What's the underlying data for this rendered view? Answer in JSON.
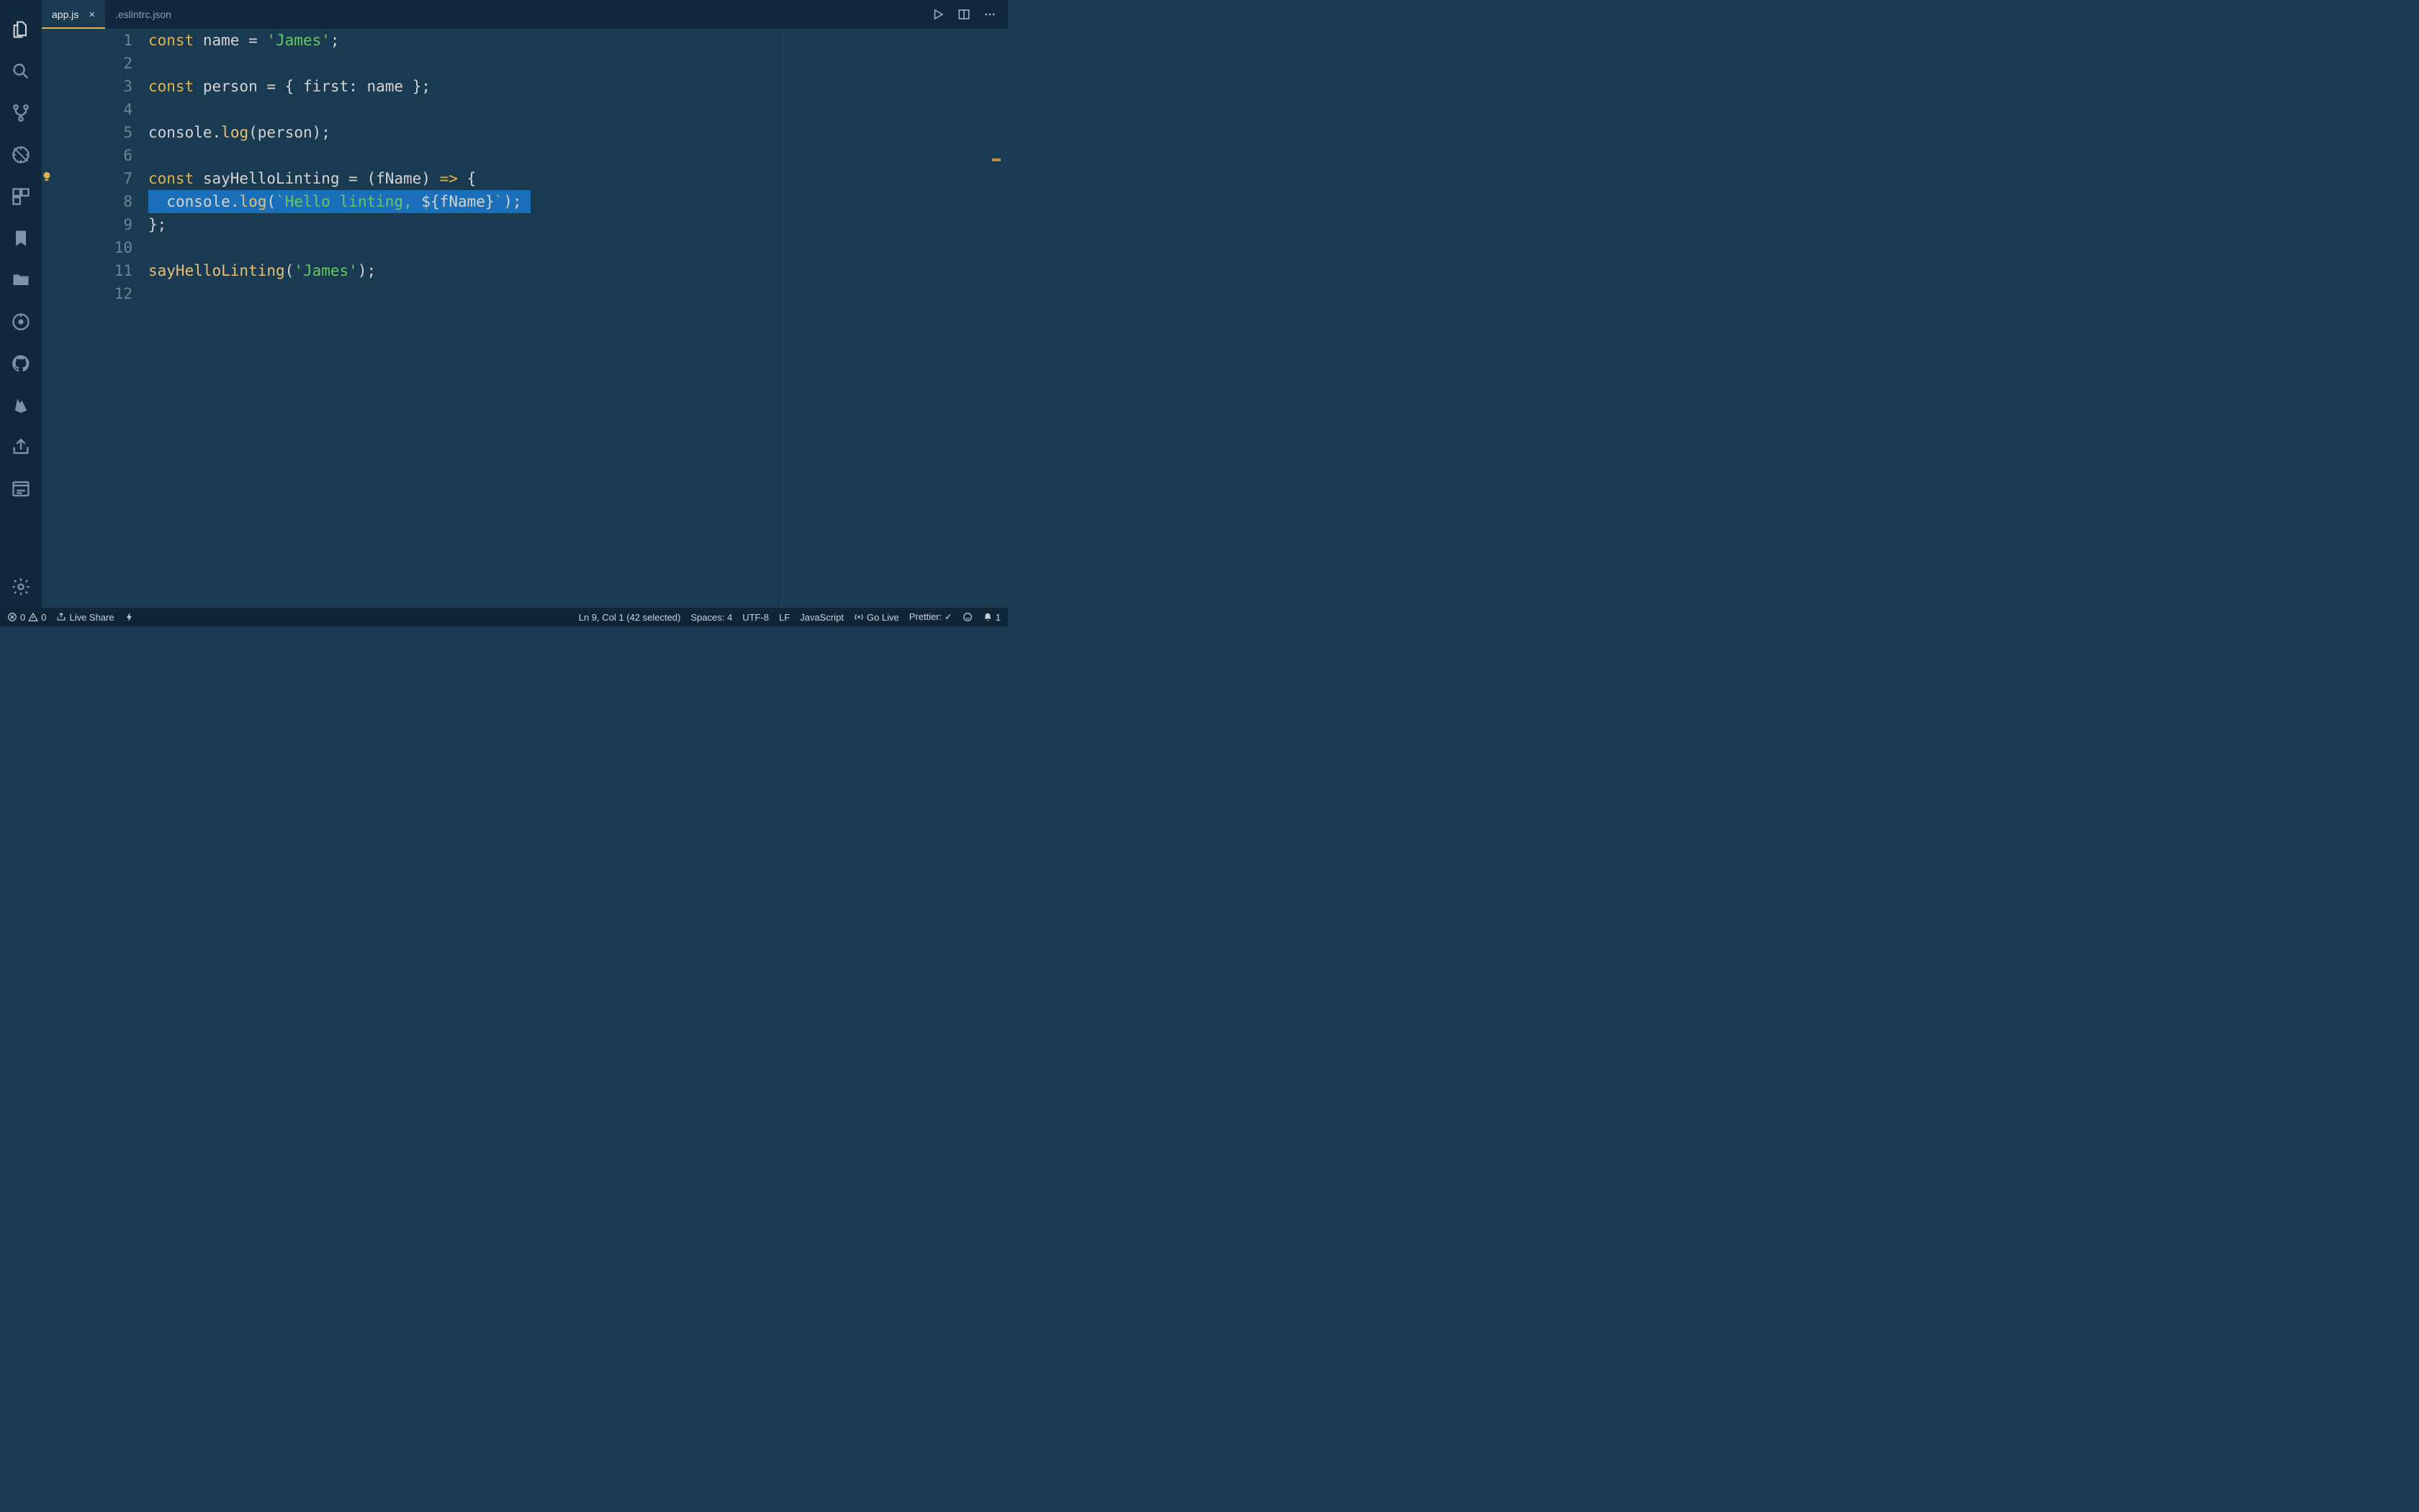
{
  "tabs": [
    {
      "label": "app.js",
      "active": true,
      "dirty": false
    },
    {
      "label": ".eslintrc.json",
      "active": false,
      "dirty": false
    }
  ],
  "tab_actions": {
    "run": "run-icon",
    "split": "split-editor-icon",
    "more": "more-icon"
  },
  "activity_icons": [
    "files-icon",
    "search-icon",
    "source-control-icon",
    "debug-icon",
    "extensions-icon",
    "bookmark-icon",
    "folder-icon",
    "gitlens-icon",
    "github-icon",
    "firebase-icon",
    "share-icon",
    "browser-icon"
  ],
  "activity_bottom": "settings-icon",
  "line_count": 12,
  "code": {
    "l1": {
      "kw": "const",
      "id": " name ",
      "op": "=",
      "str": " 'James'",
      "semi": ";"
    },
    "l3": {
      "kw": "const",
      "id": " person ",
      "op": "=",
      "brace_o": " { ",
      "key": "first",
      "colon": ":",
      "val": " name ",
      "brace_c": "}",
      "semi": ";"
    },
    "l5": {
      "obj": "console",
      "dot": ".",
      "fn": "log",
      "paren_o": "(",
      "arg": "person",
      "paren_c": ")",
      "semi": ";"
    },
    "l7": {
      "kw": "const",
      "id": " sayHelloLinting ",
      "op": "=",
      "paren_o": " (",
      "param": "fName",
      "paren_c": ")",
      "arrow": " => ",
      "brace": "{"
    },
    "l8": {
      "indent": "  ",
      "obj": "console",
      "dot": ".",
      "fn": "log",
      "paren_o": "(",
      "bt1": "`",
      "txt": "Hello linting, ",
      "intp_o": "${",
      "var": "fName",
      "intp_c": "}",
      "bt2": "`",
      "paren_c": ")",
      "semi": ";"
    },
    "l9": {
      "brace": "}",
      "semi": ";"
    },
    "l11": {
      "fn": "sayHelloLinting",
      "paren_o": "(",
      "str": "'James'",
      "paren_c": ")",
      "semi": ";"
    }
  },
  "status": {
    "errors": "0",
    "warnings": "0",
    "live_share": "Live Share",
    "cursor": "Ln 9, Col 1 (42 selected)",
    "spaces": "Spaces: 4",
    "encoding": "UTF-8",
    "eol": "LF",
    "language": "JavaScript",
    "go_live": "Go Live",
    "prettier": "Prettier: ✓",
    "bell": "1"
  }
}
